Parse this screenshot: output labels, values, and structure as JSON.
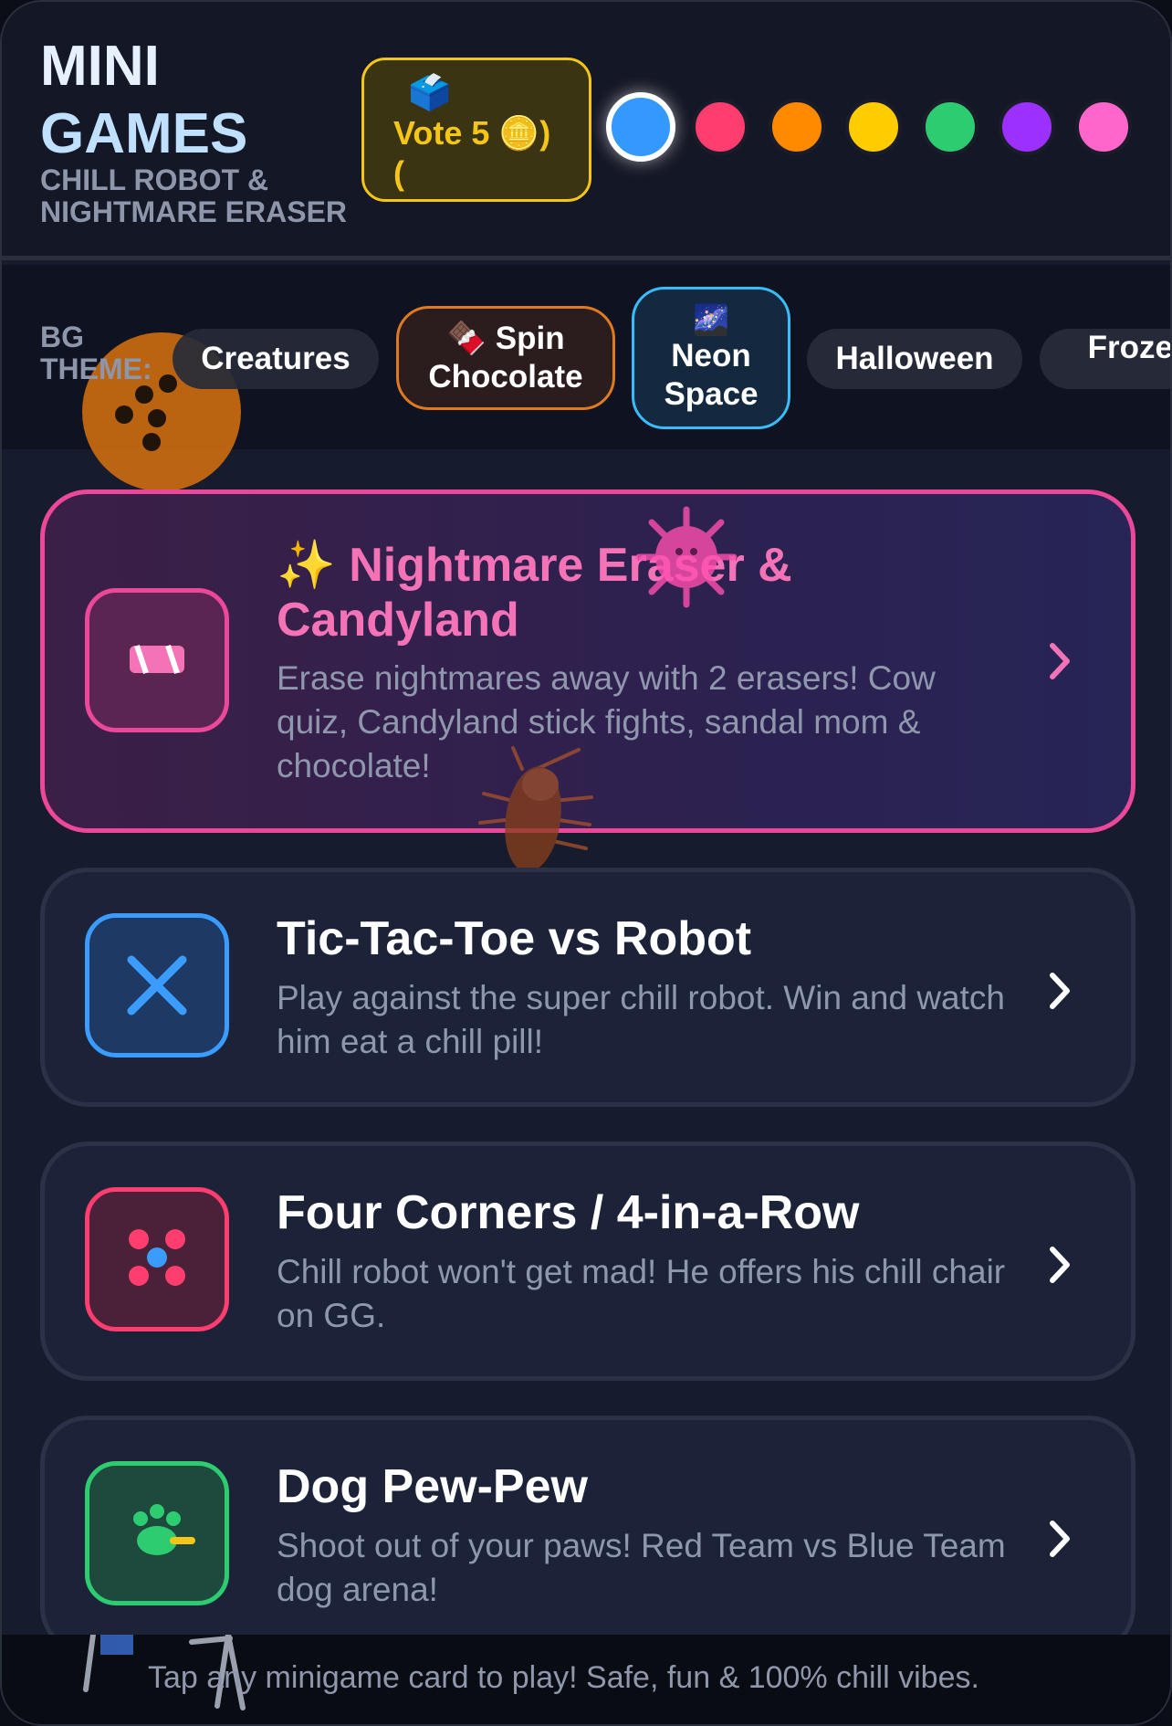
{
  "header": {
    "title_line1": "MINI",
    "title_line2": "GAMES",
    "subtitle": "CHILL ROBOT & NIGHTMARE ERASER",
    "vote": {
      "emoji": "🗳️",
      "label": "Vote  5  🪙)",
      "trailing": "("
    },
    "swatches": [
      {
        "color": "#3399ff",
        "selected": true
      },
      {
        "color": "#ff3d6e",
        "selected": false
      },
      {
        "color": "#ff8a00",
        "selected": false
      },
      {
        "color": "#ffcc00",
        "selected": false
      },
      {
        "color": "#2ecc71",
        "selected": false
      },
      {
        "color": "#9b30ff",
        "selected": false
      },
      {
        "color": "#ff66cc",
        "selected": false
      }
    ]
  },
  "theme_bar": {
    "label": "BG THEME:",
    "themes": [
      {
        "label": "Creatures",
        "emoji": ""
      },
      {
        "label": "Spin Chocolate",
        "emoji": "🍫"
      },
      {
        "label": "Neon Space",
        "emoji": "🌌",
        "selected": true
      },
      {
        "label": "Halloween",
        "emoji": ""
      },
      {
        "label": "Frozen",
        "emoji": ""
      }
    ]
  },
  "games": [
    {
      "title": "✨ Nightmare Eraser & Candyland",
      "description": "Erase nightmares away with 2 erasers! Cow quiz, Candyland stick fights, sandal mom & chocolate!",
      "icon": "eraser-icon",
      "accent": "#ec4899",
      "featured": true
    },
    {
      "title": "Tic-Tac-Toe vs Robot",
      "description": "Play against the super chill robot. Win and watch him eat a chill pill!",
      "icon": "x-mark-icon",
      "accent": "#3b9cff"
    },
    {
      "title": "Four Corners / 4-in-a-Row",
      "description": "Chill robot won't get mad! He offers his chill chair on GG.",
      "icon": "dots-icon",
      "accent": "#ff3d6e"
    },
    {
      "title": "Dog Pew-Pew",
      "description": "Shoot out of your paws! Red Team vs Blue Team dog arena!",
      "icon": "paw-icon",
      "accent": "#2ecc71"
    }
  ],
  "footer": {
    "text": "Tap any minigame card to play! Safe, fun & 100% chill vibes."
  }
}
